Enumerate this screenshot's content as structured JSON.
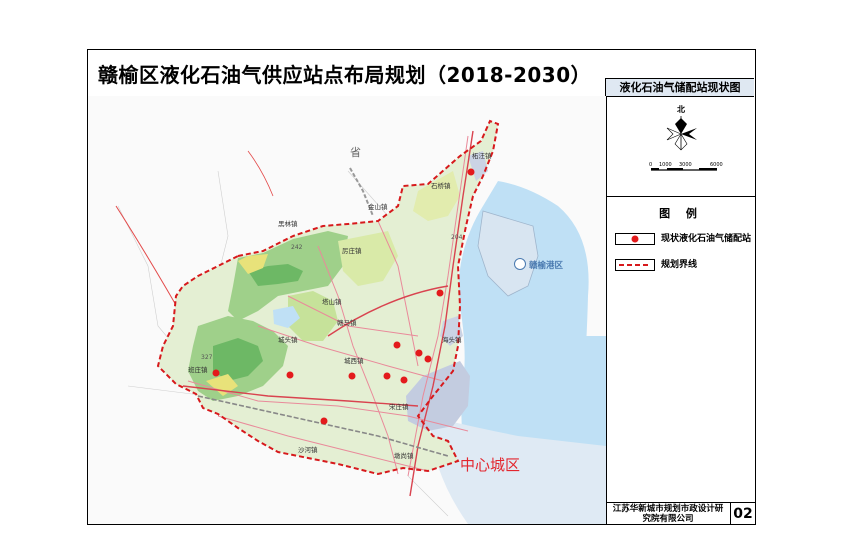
{
  "title": "赣榆区液化石油气供应站点布局规划（2018-2030）",
  "subtitle": "液化石油气储配站现状图",
  "compass": {
    "north_label": "北"
  },
  "scale_bar": {
    "labels": [
      "0",
      "1000",
      "3000",
      "6000"
    ]
  },
  "legend": {
    "title": "图 例",
    "items": [
      {
        "label": "现状液化石油气储配站"
      },
      {
        "label": "规划界线"
      }
    ]
  },
  "footer": {
    "company": "江苏华新城市规划市政设计研究院有限公司",
    "sheet": "02"
  },
  "map": {
    "district_label": "中心城区",
    "port_label": "赣榆港区",
    "province_label": "省",
    "towns": [
      "柘汪镇",
      "石桥镇",
      "金山镇",
      "黑林镇",
      "厉庄镇",
      "海头镇",
      "班庄镇",
      "塔山镇",
      "赣马镇",
      "城头镇",
      "城西镇",
      "宋庄镇",
      "沙河镇",
      "墩尚镇"
    ],
    "roads": [
      "204",
      "242",
      "327"
    ]
  },
  "colors": {
    "station": "#e31a1c",
    "boundary": "#d7191c",
    "sea": "#bfe0f5",
    "land": "#e4efd3",
    "urban": "#c3cce0",
    "title_box": "#dfe8f2"
  }
}
